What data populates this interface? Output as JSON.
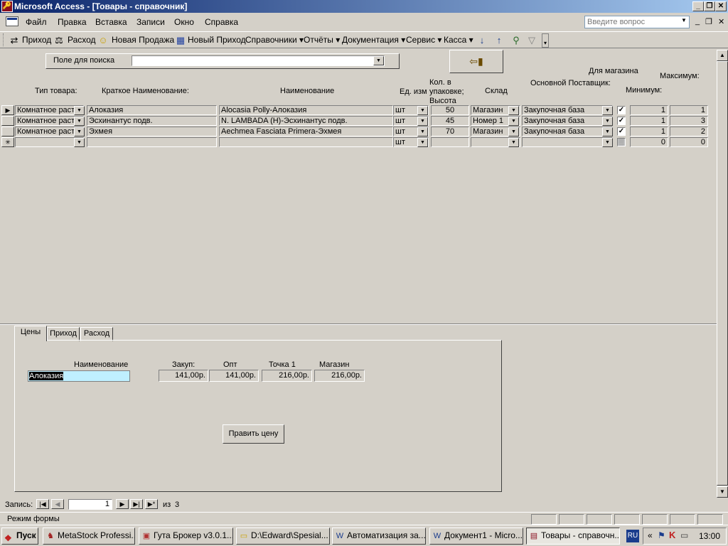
{
  "window": {
    "title": "Microsoft Access - [Товары - справочник]"
  },
  "menu": {
    "items": [
      "Файл",
      "Правка",
      "Вставка",
      "Записи",
      "Окно",
      "Справка"
    ],
    "help_placeholder": "Введите вопрос"
  },
  "toolbar": {
    "items": [
      "Приход",
      "Расход",
      "Новая Продажа",
      "Новый Приход",
      "Справочники",
      "Отчёты",
      "Документация",
      "Сервис",
      "Касса"
    ]
  },
  "search": {
    "label": "Поле для поиска",
    "value": ""
  },
  "grid": {
    "group_header": "Для магазина",
    "headers": {
      "type": "Тип товара:",
      "short": "Краткое Наименование:",
      "name": "Наименование",
      "unit": "Ед. изм",
      "pack": "Кол. в упаковке; Высота",
      "store": "Склад",
      "supplier": "Основной Поставщик:",
      "min": "Минимум:",
      "max": "Максимум:"
    },
    "rows": [
      {
        "type": "Комнатное раст",
        "short": "Алоказия",
        "name": "Alocasia Polly-Алоказия",
        "unit": "шт",
        "pack": "50",
        "store": "Магазин",
        "supplier": "Закупочная база",
        "checked": "✓",
        "min": "1",
        "max": "1"
      },
      {
        "type": "Комнатное раст",
        "short": "Эсхинантус подв.",
        "name": "N. LAMBADA (H)-Эсхинантус подв.",
        "unit": "шт",
        "pack": "45",
        "store": "Номер 1",
        "supplier": "Закупочная база",
        "checked": "✓",
        "min": "1",
        "max": "3"
      },
      {
        "type": "Комнатное раст",
        "short": "Эхмея",
        "name": "Aechmea Fasciata Primera-Эхмея",
        "unit": "шт",
        "pack": "70",
        "store": "Магазин",
        "supplier": "Закупочная база",
        "checked": "✓",
        "min": "1",
        "max": "2"
      }
    ],
    "new_row": {
      "unit": "шт",
      "min": "0",
      "max": "0"
    }
  },
  "tabs": [
    "Цены",
    "Приход",
    "Расход"
  ],
  "prices": {
    "name_label": "Наименование",
    "name_value": "Алоказия",
    "labels": [
      "Закуп:",
      "Опт",
      "Точка 1",
      "Магазин"
    ],
    "values": [
      "141,00р.",
      "141,00р.",
      "216,00р.",
      "216,00р."
    ],
    "edit_button": "Править цену"
  },
  "record_nav": {
    "label": "Запись:",
    "current": "1",
    "of_label": "из",
    "total": "3"
  },
  "status": {
    "text": "Режим формы"
  },
  "taskbar": {
    "start": "Пуск",
    "tasks": [
      "MetaStock Professi...",
      "Гута Брокер v3.0.1...",
      "D:\\Edward\\Spesial...",
      "Автоматизация за...",
      "Документ1 - Micro...",
      "Товары - справочн..."
    ],
    "lang": "RU",
    "clock": "13:00"
  }
}
